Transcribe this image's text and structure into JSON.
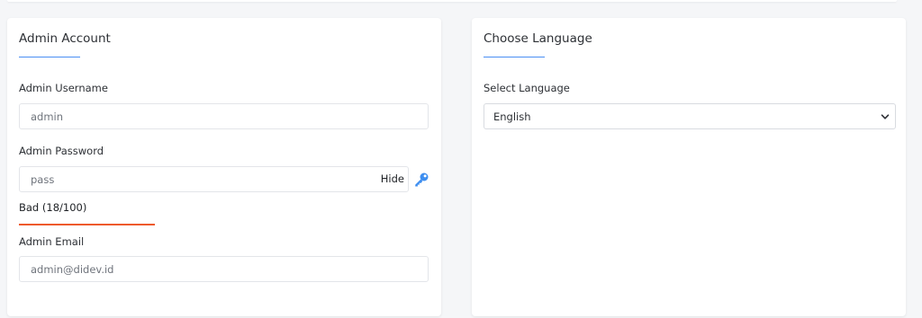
{
  "admin_account": {
    "title": "Admin Account",
    "username_label": "Admin Username",
    "username_value": "admin",
    "password_label": "Admin Password",
    "password_value": "pass",
    "hide_label": "Hide",
    "strength_text": "Bad (18/100)",
    "strength_score": 18,
    "strength_color": "#ee5a2c",
    "email_label": "Admin Email",
    "email_value": "admin@didev.id"
  },
  "language": {
    "title": "Choose Language",
    "select_label": "Select Language",
    "selected_value": "English"
  },
  "colors": {
    "accent": "#4a8ef3",
    "key_icon": "#3d8ef0"
  },
  "icons": {
    "generate_password": "key-icon",
    "dropdown": "chevron-down-icon"
  }
}
